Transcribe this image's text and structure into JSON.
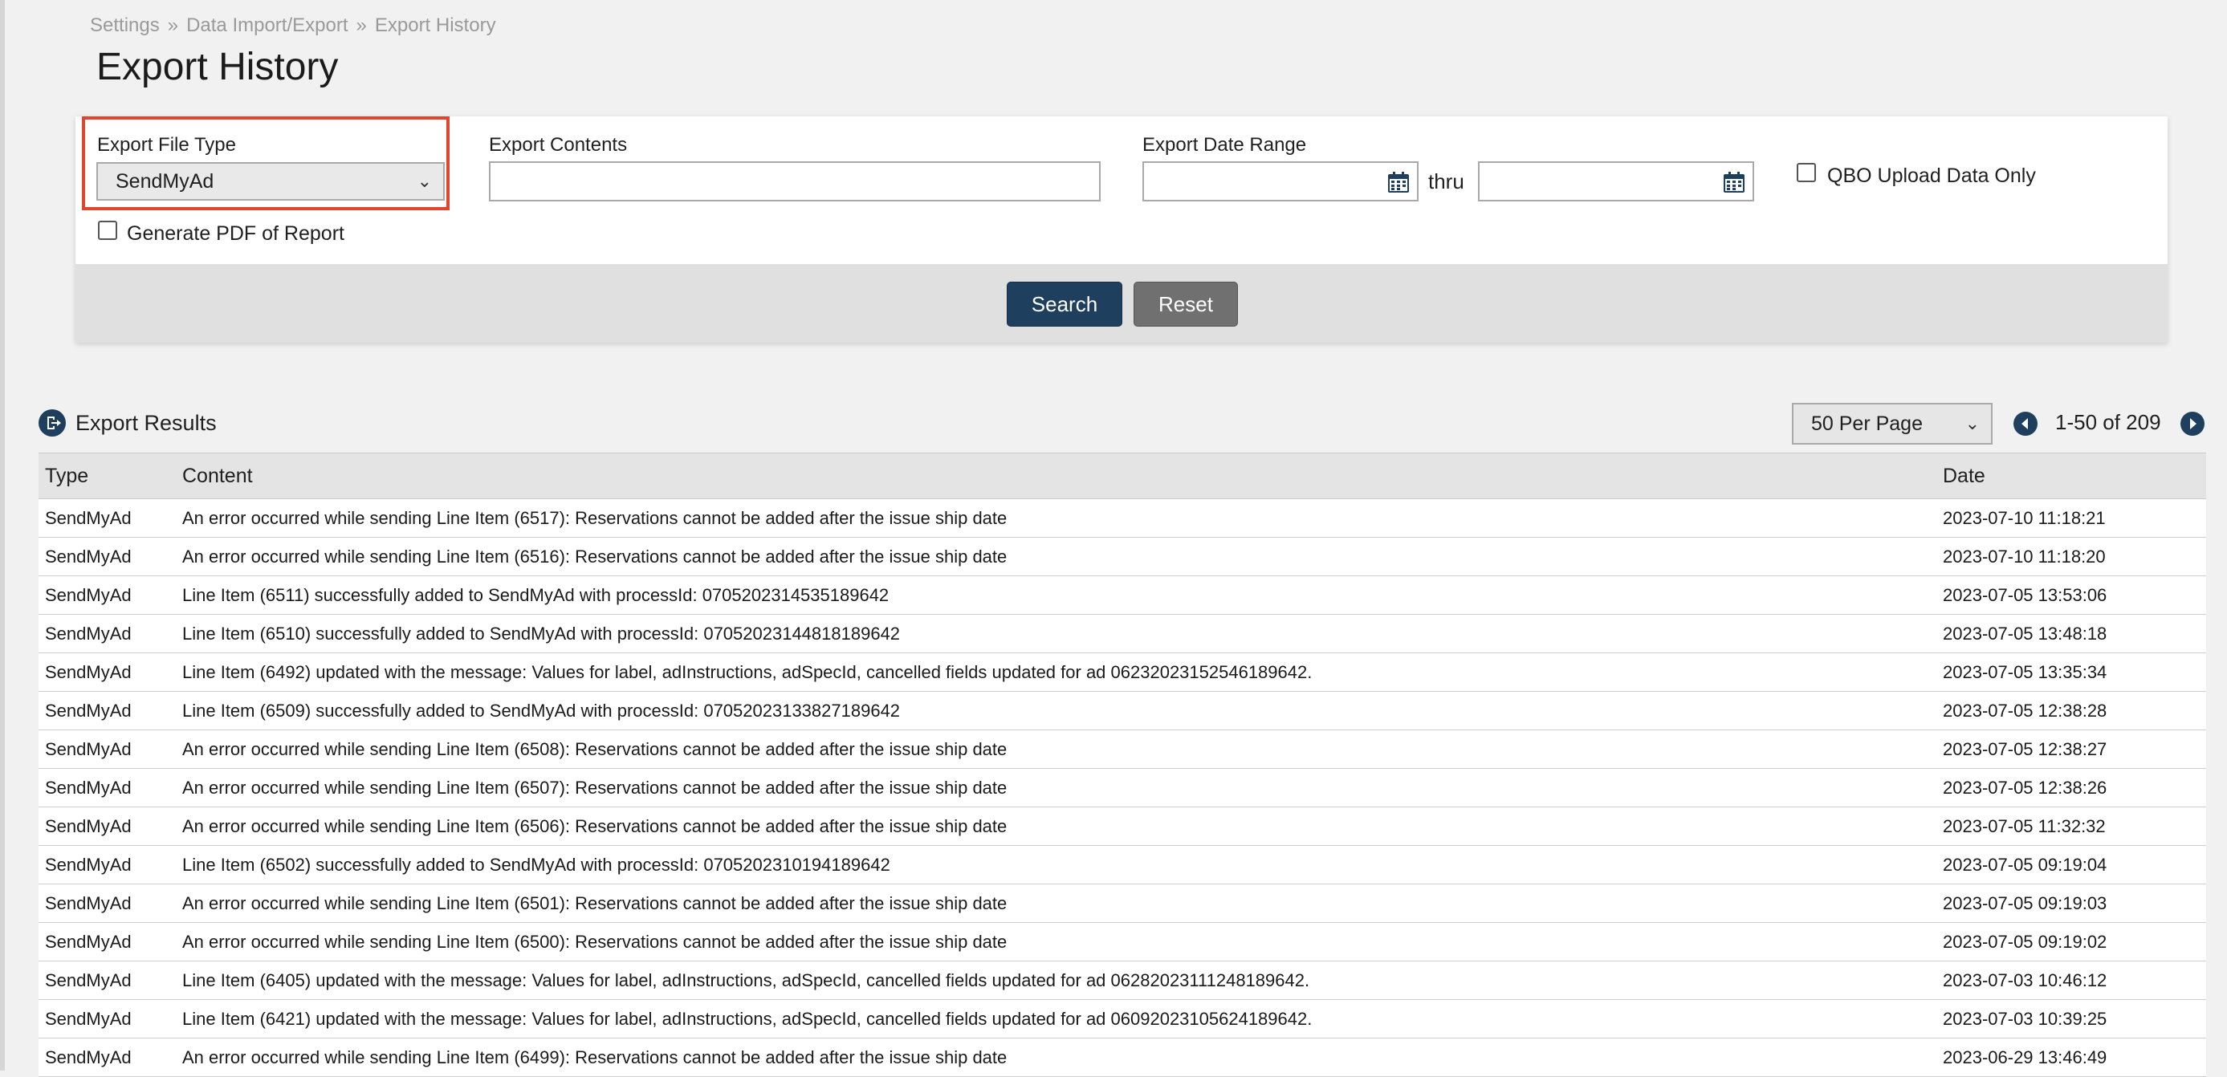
{
  "breadcrumb": [
    "Settings",
    "Data Import/Export",
    "Export History"
  ],
  "breadcrumb_sep": "»",
  "page_title": "Export History",
  "filters": {
    "file_type_label": "Export File Type",
    "file_type_value": "SendMyAd",
    "contents_label": "Export Contents",
    "contents_value": "",
    "date_range_label": "Export Date Range",
    "date_from": "",
    "date_to": "",
    "thru_label": "thru",
    "qbo_label": "QBO Upload Data Only",
    "qbo_checked": false,
    "pdf_label": "Generate PDF of Report",
    "pdf_checked": false,
    "highlight_color": "#e0462f"
  },
  "buttons": {
    "search": "Search",
    "reset": "Reset"
  },
  "colors": {
    "search_btn": "#1e3f5e",
    "reset_btn": "#707070",
    "icon": "#1e3f5e"
  },
  "results": {
    "title": "Export Results",
    "per_page": "50 Per Page",
    "range": "1-50 of 209",
    "columns": [
      "Type",
      "Content",
      "Date"
    ],
    "rows": [
      [
        "SendMyAd",
        "An error occurred while sending Line Item (6517): Reservations cannot be added after the issue ship date",
        "2023-07-10 11:18:21"
      ],
      [
        "SendMyAd",
        "An error occurred while sending Line Item (6516): Reservations cannot be added after the issue ship date",
        "2023-07-10 11:18:20"
      ],
      [
        "SendMyAd",
        "Line Item (6511) successfully added to SendMyAd with processId: 07052023145351896​42",
        "2023-07-05 13:53:06"
      ],
      [
        "SendMyAd",
        "Line Item (6510) successfully added to SendMyAd with processId: 07052023144818189642",
        "2023-07-05 13:48:18"
      ],
      [
        "SendMyAd",
        "Line Item (6492) updated with the message: Values for label, adInstructions, adSpecId, cancelled fields updated for ad 06232023152546189642.",
        "2023-07-05 13:35:34"
      ],
      [
        "SendMyAd",
        "Line Item (6509) successfully added to SendMyAd with processId: 07052023133827189642",
        "2023-07-05 12:38:28"
      ],
      [
        "SendMyAd",
        "An error occurred while sending Line Item (6508): Reservations cannot be added after the issue ship date",
        "2023-07-05 12:38:27"
      ],
      [
        "SendMyAd",
        "An error occurred while sending Line Item (6507): Reservations cannot be added after the issue ship date",
        "2023-07-05 12:38:26"
      ],
      [
        "SendMyAd",
        "An error occurred while sending Line Item (6506): Reservations cannot be added after the issue ship date",
        "2023-07-05 11:32:32"
      ],
      [
        "SendMyAd",
        "Line Item (6502) successfully added to SendMyAd with processId: 0705202310194189642",
        "2023-07-05 09:19:04"
      ],
      [
        "SendMyAd",
        "An error occurred while sending Line Item (6501): Reservations cannot be added after the issue ship date",
        "2023-07-05 09:19:03"
      ],
      [
        "SendMyAd",
        "An error occurred while sending Line Item (6500): Reservations cannot be added after the issue ship date",
        "2023-07-05 09:19:02"
      ],
      [
        "SendMyAd",
        "Line Item (6405) updated with the message: Values for label, adInstructions, adSpecId, cancelled fields updated for ad 06282023111248189642.",
        "2023-07-03 10:46:12"
      ],
      [
        "SendMyAd",
        "Line Item (6421) updated with the message: Values for label, adInstructions, adSpecId, cancelled fields updated for ad 06092023105624189642.",
        "2023-07-03 10:39:25"
      ],
      [
        "SendMyAd",
        "An error occurred while sending Line Item (6499): Reservations cannot be added after the issue ship date",
        "2023-06-29 13:46:49"
      ]
    ]
  }
}
